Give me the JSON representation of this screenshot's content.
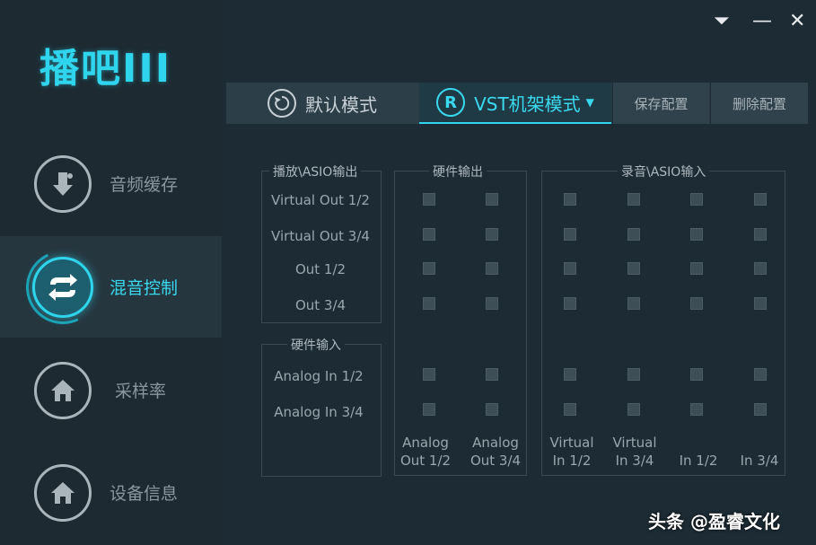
{
  "app": {
    "logo": "播吧III"
  },
  "window_controls": {
    "menu": "⏷",
    "minimize": "—",
    "close": "✕"
  },
  "sidebar": {
    "items": [
      {
        "label": "音频缓存",
        "icon": "music-download-icon"
      },
      {
        "label": "混音控制",
        "icon": "mixer-swap-icon"
      },
      {
        "label": "采样率",
        "icon": "home-icon"
      },
      {
        "label": "设备信息",
        "icon": "home-icon"
      }
    ],
    "active_index": 1
  },
  "tabs": {
    "default_mode": "默认模式",
    "vst_mode": "VST机架模式",
    "vst_icon_letter": "R",
    "save_config": "保存配置",
    "delete_config": "删除配置"
  },
  "matrix": {
    "playback_title": "播放\\ASIO输出",
    "hardware_out_title": "硬件输出",
    "recording_title": "录音\\ASIO输入",
    "hardware_in_title": "硬件输入",
    "playback_rows": [
      "Virtual Out 1/2",
      "Virtual Out 3/4",
      "Out 1/2",
      "Out 3/4"
    ],
    "input_rows": [
      "Analog In 1/2",
      "Analog In 3/4"
    ],
    "hardware_out_cols": [
      "Analog\nOut 1/2",
      "Analog\nOut 3/4"
    ],
    "recording_cols": [
      "Virtual\nIn 1/2",
      "Virtual\nIn 3/4",
      "In 1/2",
      "In 3/4"
    ]
  },
  "watermark": "头条 @盈睿文化",
  "colors": {
    "accent": "#2fd5ec",
    "background": "#1c2b34",
    "sidebar": "#1d2a32"
  }
}
